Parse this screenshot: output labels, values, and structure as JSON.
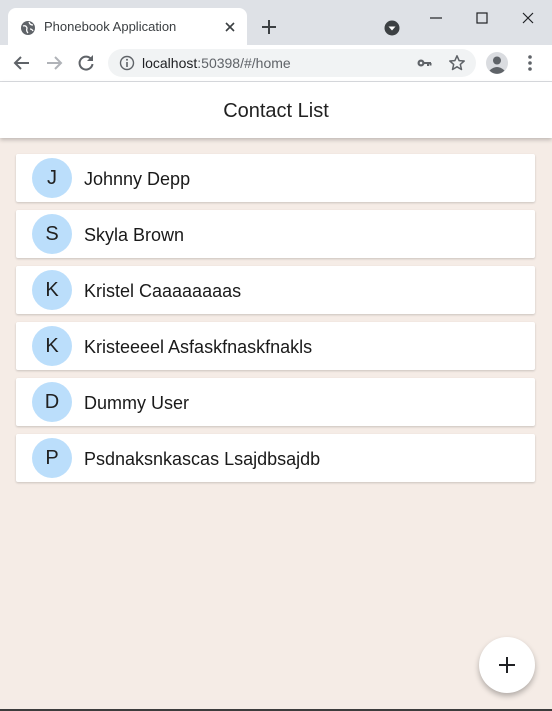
{
  "browser": {
    "tab_title": "Phonebook Application",
    "url_host": "localhost",
    "url_rest": ":50398/#/home"
  },
  "app": {
    "title": "Contact List",
    "avatar_color": "#bbdefb",
    "background_color": "#f5ece6",
    "contacts": [
      {
        "initial": "J",
        "name": "Johnny Depp"
      },
      {
        "initial": "S",
        "name": "Skyla Brown"
      },
      {
        "initial": "K",
        "name": "Kristel Caaaaaaaas"
      },
      {
        "initial": "K",
        "name": "Kristeeeel Asfaskfnaskfnakls"
      },
      {
        "initial": "D",
        "name": "Dummy User"
      },
      {
        "initial": "P",
        "name": "Psdnaksnkascas Lsajdbsajdb"
      }
    ],
    "fab_icon": "plus-icon"
  }
}
